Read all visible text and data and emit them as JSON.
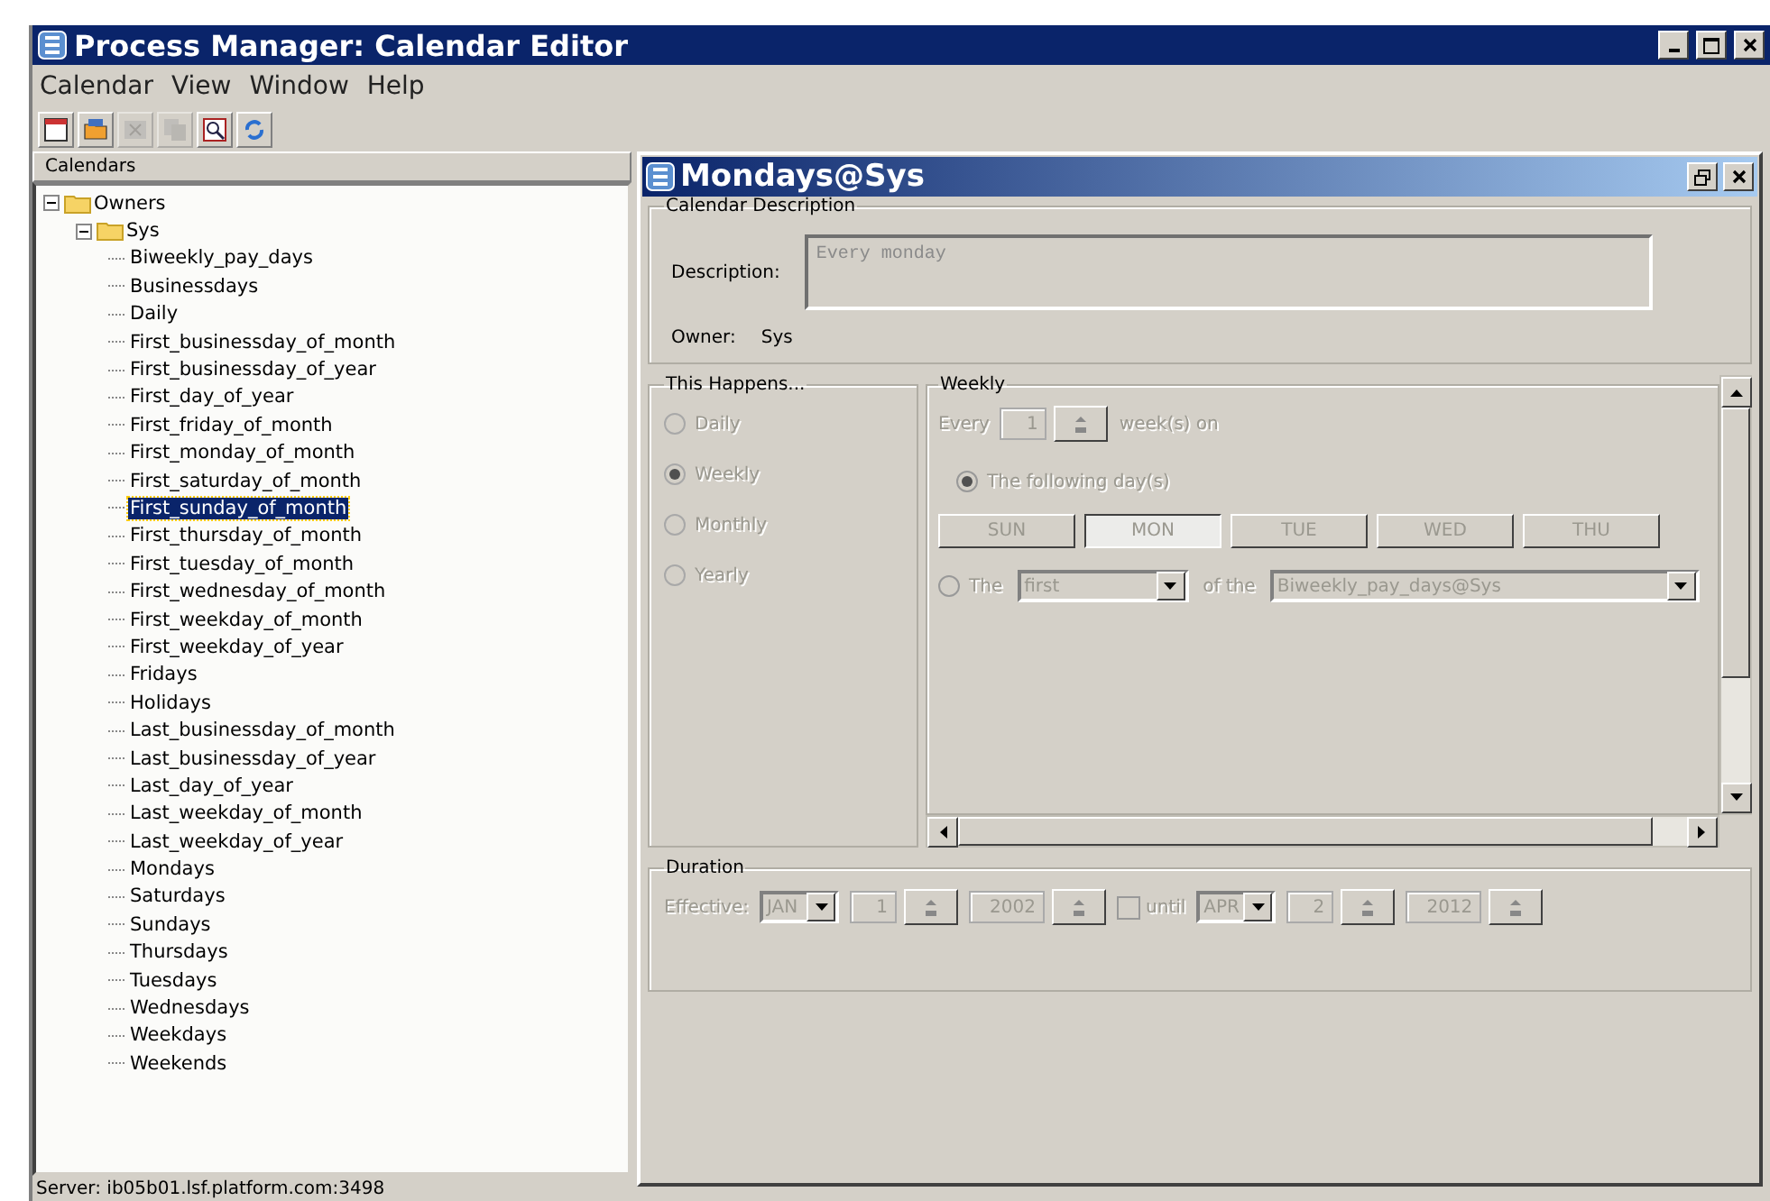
{
  "window": {
    "title": "Process Manager: Calendar Editor"
  },
  "menu": [
    "Calendar",
    "View",
    "Window",
    "Help"
  ],
  "toolbar": [
    {
      "kind": "new",
      "disabled": false
    },
    {
      "kind": "open",
      "disabled": false
    },
    {
      "kind": "delete",
      "disabled": true
    },
    {
      "kind": "copy",
      "disabled": true
    },
    {
      "kind": "preview",
      "disabled": false
    },
    {
      "kind": "refresh",
      "disabled": false
    }
  ],
  "calendars": {
    "header": "Calendars",
    "tree": [
      {
        "label": "Owners",
        "expanded": true,
        "children": [
          {
            "label": "Sys",
            "expanded": true,
            "children": [
              {
                "label": "Biweekly_pay_days",
                "selected": false
              },
              {
                "label": "Businessdays",
                "selected": false
              },
              {
                "label": "Daily",
                "selected": false
              },
              {
                "label": "First_businessday_of_month",
                "selected": false
              },
              {
                "label": "First_businessday_of_year",
                "selected": false
              },
              {
                "label": "First_day_of_year",
                "selected": false
              },
              {
                "label": "First_friday_of_month",
                "selected": false
              },
              {
                "label": "First_monday_of_month",
                "selected": false
              },
              {
                "label": "First_saturday_of_month",
                "selected": false
              },
              {
                "label": "First_sunday_of_month",
                "selected": true
              },
              {
                "label": "First_thursday_of_month",
                "selected": false
              },
              {
                "label": "First_tuesday_of_month",
                "selected": false
              },
              {
                "label": "First_wednesday_of_month",
                "selected": false
              },
              {
                "label": "First_weekday_of_month",
                "selected": false
              },
              {
                "label": "First_weekday_of_year",
                "selected": false
              },
              {
                "label": "Fridays",
                "selected": false
              },
              {
                "label": "Holidays",
                "selected": false
              },
              {
                "label": "Last_businessday_of_month",
                "selected": false
              },
              {
                "label": "Last_businessday_of_year",
                "selected": false
              },
              {
                "label": "Last_day_of_year",
                "selected": false
              },
              {
                "label": "Last_weekday_of_month",
                "selected": false
              },
              {
                "label": "Last_weekday_of_year",
                "selected": false
              },
              {
                "label": "Mondays",
                "selected": false
              },
              {
                "label": "Saturdays",
                "selected": false
              },
              {
                "label": "Sundays",
                "selected": false
              },
              {
                "label": "Thursdays",
                "selected": false
              },
              {
                "label": "Tuesdays",
                "selected": false
              },
              {
                "label": "Wednesdays",
                "selected": false
              },
              {
                "label": "Weekdays",
                "selected": false
              },
              {
                "label": "Weekends",
                "selected": false
              }
            ]
          }
        ]
      }
    ]
  },
  "editor": {
    "title": "Mondays@Sys",
    "description_group": {
      "title": "Calendar Description",
      "description_label": "Description:",
      "description": "Every monday",
      "owner_label": "Owner:",
      "owner": "Sys"
    },
    "this_happens": {
      "title": "This Happens...",
      "disabled": true,
      "options": [
        {
          "label": "Daily",
          "selected": false
        },
        {
          "label": "Weekly",
          "selected": true
        },
        {
          "label": "Monthly",
          "selected": false
        },
        {
          "label": "Yearly",
          "selected": false
        }
      ]
    },
    "weekly": {
      "title": "Weekly",
      "every_label": "Every",
      "every": "1",
      "every_suffix": "week(s) on",
      "following": {
        "label": "The following day(s)",
        "selected": true
      },
      "days": [
        {
          "label": "SUN",
          "selected": false
        },
        {
          "label": "MON",
          "selected": true
        },
        {
          "label": "TUE",
          "selected": false
        },
        {
          "label": "WED",
          "selected": false
        },
        {
          "label": "THU",
          "selected": false
        }
      ],
      "the": {
        "label": "The",
        "selected": false,
        "ordinal": "first",
        "of_label": "of the",
        "calendar": "Biweekly_pay_days@Sys"
      }
    },
    "duration": {
      "title": "Duration",
      "effective_label": "Effective:",
      "start": {
        "month": "JAN",
        "day": "1",
        "year": "2002"
      },
      "until": {
        "label": "until",
        "checked": false
      },
      "end": {
        "month": "APR",
        "day": "2",
        "year": "2012"
      }
    }
  },
  "status_bar": "Server: ib05b01.lsf.platform.com:3498"
}
